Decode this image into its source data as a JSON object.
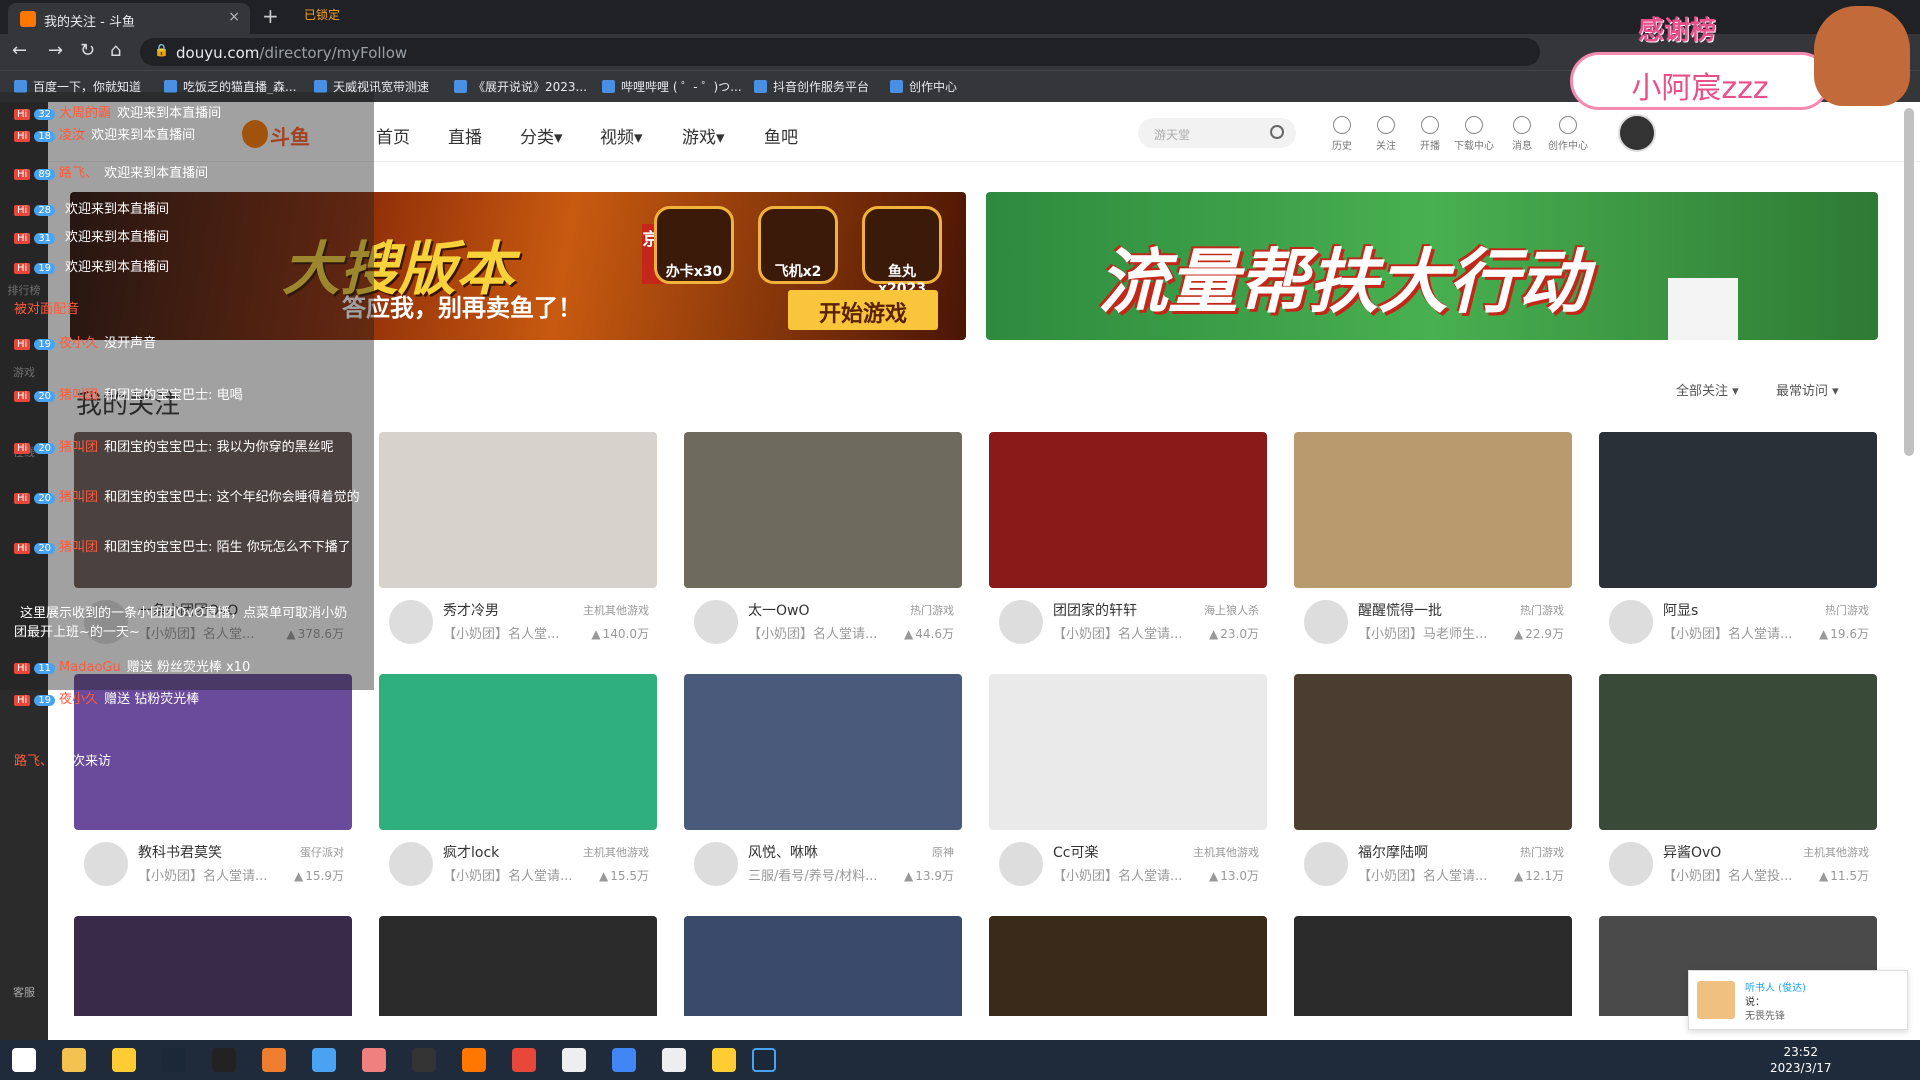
{
  "browser": {
    "tab_title": "我的关注 - 斗鱼",
    "tab_close": "×",
    "new_tab": "+",
    "locked_label": "已锁定",
    "url_host": "douyu.com",
    "url_path": "/directory/myFollow"
  },
  "bookmarks": [
    "百度一下，你就知道",
    "吃饭乏的猫直播_森...",
    "天威视讯宽带测速",
    "《展开说说》2023...",
    "哔哩哔哩 ( ゜- ゜)つ...",
    "抖音创作服务平台",
    "创作中心"
  ],
  "site": {
    "logo": "斗鱼",
    "nav": [
      "首页",
      "直播",
      "分类",
      "视频",
      "游戏",
      "鱼吧"
    ],
    "search_placeholder": "游天堂",
    "tools": [
      "历史",
      "关注",
      "开播",
      "下载中心",
      "消息",
      "创作中心"
    ]
  },
  "banner1": {
    "title": "大搜版本",
    "subtitle": "答应我，别再卖鱼了！",
    "tag": "京海捞金",
    "chips": [
      "办卡x30",
      "飞机x2",
      "鱼丸x2023"
    ],
    "button": "开始游戏"
  },
  "banner2": {
    "title": "流量帮扶大行动"
  },
  "section_title": "我的关注",
  "filters": {
    "all": "全部关注",
    "sort": "最常访问"
  },
  "cards": [
    {
      "name": "一条小团团OvO",
      "category": "",
      "title": "【小奶团】名人堂...",
      "hot": "378.6万",
      "color": "#6b5a56"
    },
    {
      "name": "秀才冷男",
      "category": "主机其他游戏",
      "title": "【小奶团】名人堂...",
      "hot": "140.0万",
      "color": "#d8d2cc"
    },
    {
      "name": "太一OwO",
      "category": "热门游戏",
      "title": "【小奶团】名人堂请...",
      "hot": "44.6万",
      "color": "#6e6a5e"
    },
    {
      "name": "团团家的轩轩",
      "category": "海上狼人杀",
      "title": "【小奶团】名人堂请...",
      "hot": "23.0万",
      "color": "#8a1a1a"
    },
    {
      "name": "醒醒慌得一批",
      "category": "热门游戏",
      "title": "【小奶团】马老师生...",
      "hot": "22.9万",
      "color": "#b89a6e"
    },
    {
      "name": "阿显s",
      "category": "热门游戏",
      "title": "【小奶团】名人堂请...",
      "hot": "19.6万",
      "color": "#2a3038"
    },
    {
      "name": "教科书君莫笑",
      "category": "蛋仔派对",
      "title": "【小奶团】名人堂请...",
      "hot": "15.9万",
      "color": "#6a4a9a"
    },
    {
      "name": "疯才lock",
      "category": "主机其他游戏",
      "title": "【小奶团】名人堂请...",
      "hot": "15.5万",
      "color": "#2fae7e"
    },
    {
      "name": "风悦、咻咻",
      "category": "原神",
      "title": "三服/看号/养号/材料...",
      "hot": "13.9万",
      "color": "#4a5a7a"
    },
    {
      "name": "Cc可楽",
      "category": "主机其他游戏",
      "title": "【小奶团】名人堂请...",
      "hot": "13.0万",
      "color": "#eaeaea"
    },
    {
      "name": "福尔摩陆啊",
      "category": "热门游戏",
      "title": "【小奶团】名人堂请...",
      "hot": "12.1万",
      "color": "#4a3e30"
    },
    {
      "name": "异酱OvO",
      "category": "主机其他游戏",
      "title": "【小奶团】名人堂投...",
      "hot": "11.5万",
      "color": "#3a4a38"
    },
    {
      "name": "",
      "category": "",
      "title": "",
      "hot": "",
      "color": "#3a2a4a"
    },
    {
      "name": "",
      "category": "",
      "title": "",
      "hot": "",
      "color": "#2a2a2a"
    },
    {
      "name": "",
      "category": "",
      "title": "",
      "hot": "",
      "color": "#3a4a6a"
    },
    {
      "name": "",
      "category": "",
      "title": "",
      "hot": "",
      "color": "#3a2a1a"
    },
    {
      "name": "",
      "category": "",
      "title": "",
      "hot": "",
      "color": "#2a2a2a"
    },
    {
      "name": "",
      "category": "",
      "title": "",
      "hot": "",
      "color": "#4a4a4a"
    }
  ],
  "chat": [
    {
      "lv": "32",
      "user": "大周的霸",
      "msg": "欢迎来到本直播间"
    },
    {
      "lv": "18",
      "user": "凌汝",
      "msg": "欢迎来到本直播间"
    },
    {
      "lv": "89",
      "user": "路飞、",
      "msg": "欢迎来到本直播间"
    },
    {
      "lv": "28",
      "user": "",
      "msg": "欢迎来到本直播间"
    },
    {
      "lv": "31",
      "user": "",
      "msg": "欢迎来到本直播间"
    },
    {
      "lv": "19",
      "user": "",
      "msg": "欢迎来到本直播间"
    },
    {
      "lv": "",
      "user": "被对面配音",
      "msg": ""
    },
    {
      "lv": "19",
      "user": "夜小久",
      "msg": "没开声音"
    },
    {
      "lv": "20",
      "user": "猪叫团",
      "msg": "和团宝的宝宝巴士: 电喝"
    },
    {
      "lv": "20",
      "user": "猪叫团",
      "msg": "和团宝的宝宝巴士: 我以为你穿的黑丝呢"
    },
    {
      "lv": "20",
      "user": "猪叫团",
      "msg": "和团宝的宝宝巴士: 这个年纪你会睡得着觉的"
    },
    {
      "lv": "20",
      "user": "猪叫团",
      "msg": "和团宝的宝宝巴士: 陌生 你玩怎么不下播了"
    },
    {
      "lv": "",
      "user": "",
      "msg": "这里展示收到的一条小团团OvO直播，点菜单可取消小奶团最开上班~的一天~"
    },
    {
      "lv": "11",
      "user": "MadaoGu",
      "msg": "赠送 粉丝荧光棒 x10"
    },
    {
      "lv": "19",
      "user": "夜小久",
      "msg": "赠送 钻粉荧光棒"
    },
    {
      "lv": "",
      "user": "路飞、",
      "msg": "首次来访"
    }
  ],
  "side_labels": [
    "排行榜",
    "游戏",
    "在线",
    "客服"
  ],
  "overlay": {
    "title": "感谢榜",
    "name": "小阿宸zzz"
  },
  "toast": {
    "title": "听书人 (俊达)",
    "line2": "说：",
    "line3": "无畏先锋"
  },
  "clock": {
    "time": "23:52",
    "date": "2023/3/17"
  },
  "colors": {
    "accent": "#ff5d23",
    "link": "#1e9fff"
  }
}
